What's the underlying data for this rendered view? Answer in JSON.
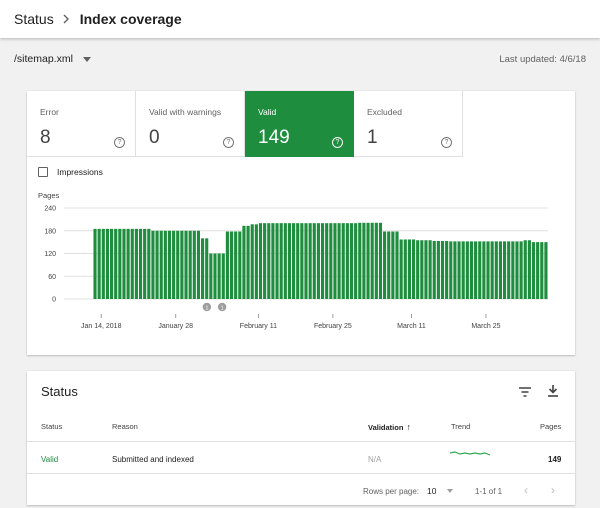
{
  "breadcrumb": {
    "root": "Status",
    "current": "Index coverage"
  },
  "sitemap": {
    "selected": "/sitemap.xml"
  },
  "last_updated": "Last updated: 4/6/18",
  "tiles": [
    {
      "label": "Error",
      "value": "8",
      "active": false
    },
    {
      "label": "Valid with warnings",
      "value": "0",
      "active": false
    },
    {
      "label": "Valid",
      "value": "149",
      "active": true
    },
    {
      "label": "Excluded",
      "value": "1",
      "active": false
    }
  ],
  "help_glyph": "?",
  "impressions_label": "Impressions",
  "colors": {
    "accent": "#1e8e3e",
    "bar": "#1e8e3e",
    "trend": "#34a853"
  },
  "chart_data": {
    "type": "bar",
    "ylabel": "Pages",
    "ylim": [
      0,
      240
    ],
    "yticks": [
      "0",
      "60",
      "120",
      "180",
      "240"
    ],
    "xtick_labels": [
      "Jan 14, 2018",
      "January 28",
      "February 11",
      "February 25",
      "March 11",
      "March 25"
    ],
    "annotations": [
      "1",
      "1"
    ],
    "values": [
      0,
      0,
      0,
      0,
      0,
      0,
      0,
      185,
      185,
      185,
      185,
      185,
      185,
      185,
      185,
      185,
      185,
      185,
      185,
      185,
      185,
      180,
      180,
      180,
      180,
      180,
      180,
      180,
      180,
      180,
      180,
      180,
      180,
      160,
      160,
      120,
      120,
      120,
      120,
      178,
      178,
      178,
      178,
      193,
      193,
      197,
      197,
      200,
      200,
      200,
      200,
      200,
      200,
      200,
      200,
      200,
      200,
      200,
      200,
      200,
      200,
      200,
      200,
      200,
      200,
      200,
      200,
      200,
      200,
      200,
      200,
      201,
      201,
      201,
      201,
      201,
      201,
      178,
      178,
      178,
      178,
      157,
      157,
      157,
      157,
      155,
      155,
      155,
      155,
      153,
      153,
      153,
      153,
      152,
      152,
      152,
      152,
      152,
      152,
      152,
      152,
      152,
      152,
      152,
      152,
      152,
      152,
      152,
      152,
      152,
      152,
      155,
      155,
      150,
      150,
      150,
      150
    ]
  },
  "status_table": {
    "title": "Status",
    "columns": {
      "status": "Status",
      "reason": "Reason",
      "validation": "Validation",
      "sort_glyph": "↑",
      "trend": "Trend",
      "pages": "Pages"
    },
    "rows": [
      {
        "status": "Valid",
        "reason": "Submitted and indexed",
        "validation": "N/A",
        "pages": "149"
      }
    ],
    "pagination": {
      "rows_per_page_label": "Rows per page:",
      "rows_per_page": "10",
      "range": "1-1 of 1",
      "prev": "‹",
      "next": "›"
    }
  }
}
